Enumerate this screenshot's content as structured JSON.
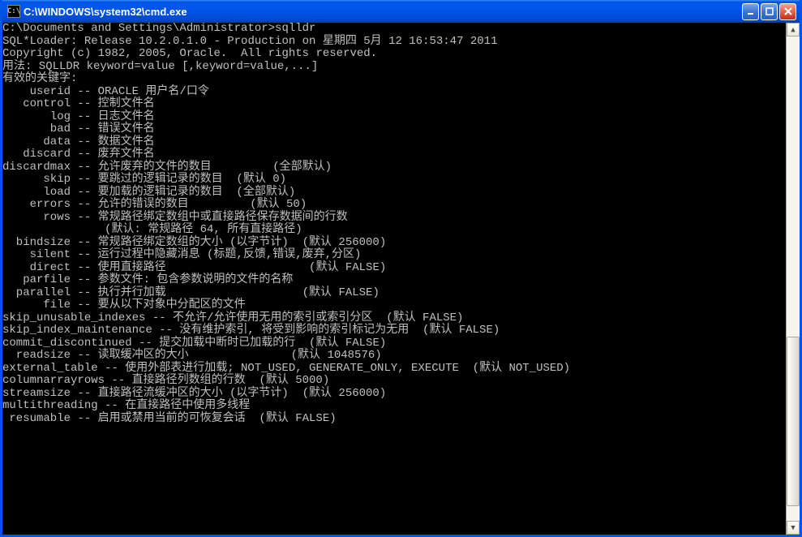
{
  "window": {
    "icon_text": "C:\\",
    "title": "C:\\WINDOWS\\system32\\cmd.exe"
  },
  "terminal": {
    "prompt_line": "C:\\Documents and Settings\\Administrator>sqlldr",
    "blank": "",
    "version_line": "SQL*Loader: Release 10.2.0.1.0 - Production on 星期四 5月 12 16:53:47 2011",
    "copyright_line": "Copyright (c) 1982, 2005, Oracle.  All rights reserved.",
    "usage_line": "用法: SQLLDR keyword=value [,keyword=value,...]",
    "valid_keywords_header": "有效的关键字:",
    "l01": "    userid -- ORACLE 用户名/口令",
    "l02": "   control -- 控制文件名",
    "l03": "       log -- 日志文件名",
    "l04": "       bad -- 错误文件名",
    "l05": "      data -- 数据文件名",
    "l06": "   discard -- 废弃文件名",
    "l07": "discardmax -- 允许废弃的文件的数目         (全部默认)",
    "l08": "      skip -- 要跳过的逻辑记录的数目  (默认 0)",
    "l09": "      load -- 要加载的逻辑记录的数目  (全部默认)",
    "l10": "    errors -- 允许的错误的数目         (默认 50)",
    "l11": "      rows -- 常规路径绑定数组中或直接路径保存数据间的行数",
    "l12": "               (默认: 常规路径 64, 所有直接路径)",
    "l13": "  bindsize -- 常规路径绑定数组的大小 (以字节计)  (默认 256000)",
    "l14": "    silent -- 运行过程中隐藏消息 (标题,反馈,错误,废弃,分区)",
    "l15": "    direct -- 使用直接路径                     (默认 FALSE)",
    "l16": "   parfile -- 参数文件: 包含参数说明的文件的名称",
    "l17": "  parallel -- 执行并行加载                    (默认 FALSE)",
    "l18": "      file -- 要从以下对象中分配区的文件",
    "l19": "skip_unusable_indexes -- 不允许/允许使用无用的索引或索引分区  (默认 FALSE)",
    "l20": "skip_index_maintenance -- 没有维护索引, 将受到影响的索引标记为无用  (默认 FALSE)",
    "l21": "commit_discontinued -- 提交加载中断时已加载的行  (默认 FALSE)",
    "l22": "  readsize -- 读取缓冲区的大小               (默认 1048576)",
    "l23": "external_table -- 使用外部表进行加载; NOT_USED, GENERATE_ONLY, EXECUTE  (默认 NOT_USED)",
    "l24": "columnarrayrows -- 直接路径列数组的行数  (默认 5000)",
    "l25": "streamsize -- 直接路径流缓冲区的大小 (以字节计)  (默认 256000)",
    "l26": "multithreading -- 在直接路径中使用多线程",
    "l27": " resumable -- 启用或禁用当前的可恢复会话  (默认 FALSE)"
  }
}
